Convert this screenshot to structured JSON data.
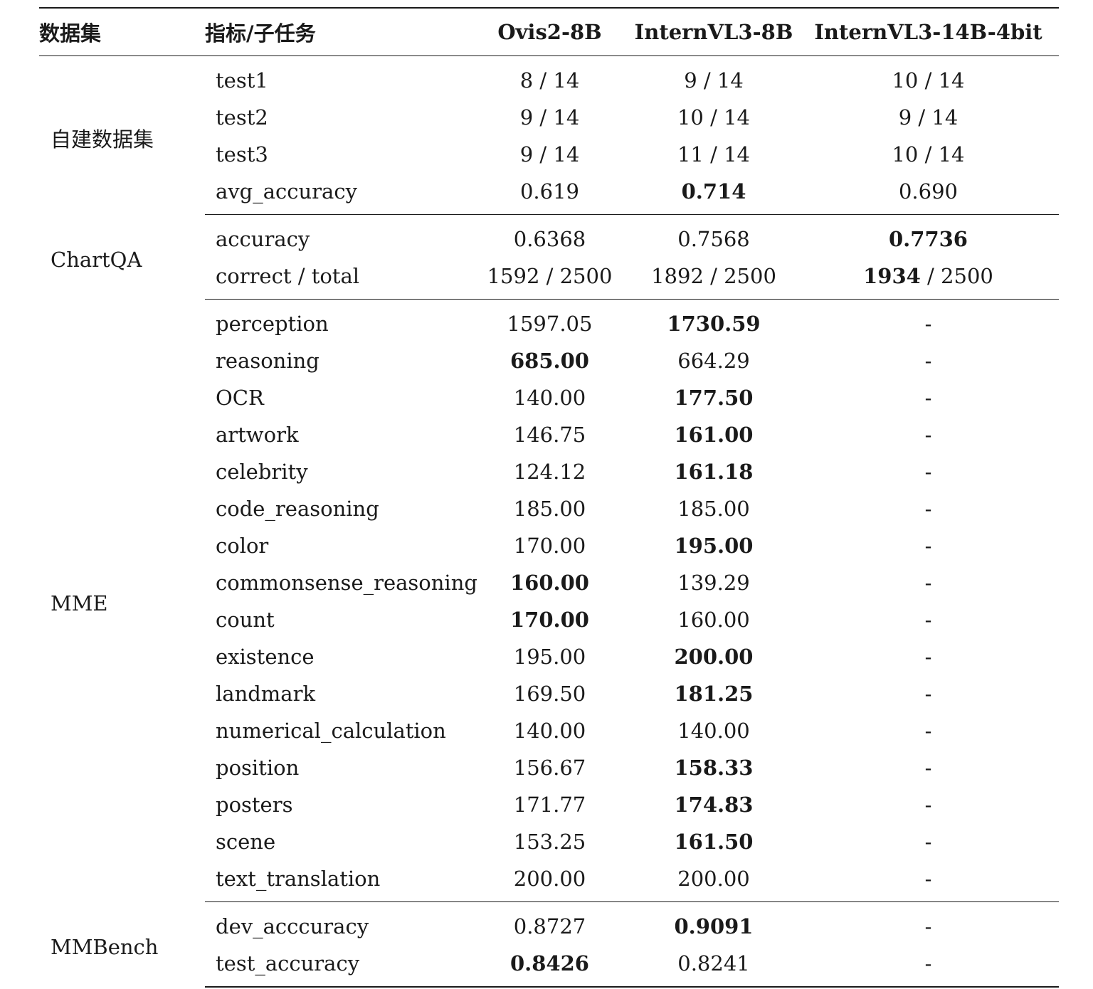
{
  "header": {
    "dataset": "数据集",
    "metric": "指标/子任务",
    "model1": "Ovis2-8B",
    "model2": "InternVL3-8B",
    "model3": "InternVL3-14B-4bit"
  },
  "groups": [
    {
      "dataset": "自建数据集",
      "rows": [
        {
          "metric": "test1",
          "m1": "8 / 14",
          "m2": "9 / 14",
          "m3": "10 / 14"
        },
        {
          "metric": "test2",
          "m1": "9 / 14",
          "m2": "10 / 14",
          "m3": "9 / 14"
        },
        {
          "metric": "test3",
          "m1": "9 / 14",
          "m2": "11 / 14",
          "m3": "10 / 14"
        },
        {
          "metric": "avg_accuracy",
          "m1": "0.619",
          "m2": "0.714",
          "m3": "0.690"
        }
      ]
    },
    {
      "dataset": "ChartQA",
      "rows": [
        {
          "metric": "accuracy",
          "m1": "0.6368",
          "m2": "0.7568",
          "m3": "0.7736"
        },
        {
          "metric": "correct / total",
          "m1": "1592 / 2500",
          "m2": "1892 / 2500",
          "m3_bold": "1934",
          "m3_rest": " / 2500"
        }
      ]
    },
    {
      "dataset": "MME",
      "rows": [
        {
          "metric": "perception",
          "m1": "1597.05",
          "m2": "1730.59",
          "m3": "-"
        },
        {
          "metric": "reasoning",
          "m1": "685.00",
          "m2": "664.29",
          "m3": "-"
        },
        {
          "metric": "OCR",
          "m1": "140.00",
          "m2": "177.50",
          "m3": "-"
        },
        {
          "metric": "artwork",
          "m1": "146.75",
          "m2": "161.00",
          "m3": "-"
        },
        {
          "metric": "celebrity",
          "m1": "124.12",
          "m2": "161.18",
          "m3": "-"
        },
        {
          "metric": "code_reasoning",
          "m1": "185.00",
          "m2": "185.00",
          "m3": "-"
        },
        {
          "metric": "color",
          "m1": "170.00",
          "m2": "195.00",
          "m3": "-"
        },
        {
          "metric": "commonsense_reasoning",
          "m1": "160.00",
          "m2": "139.29",
          "m3": "-"
        },
        {
          "metric": "count",
          "m1": "170.00",
          "m2": "160.00",
          "m3": "-"
        },
        {
          "metric": "existence",
          "m1": "195.00",
          "m2": "200.00",
          "m3": "-"
        },
        {
          "metric": "landmark",
          "m1": "169.50",
          "m2": "181.25",
          "m3": "-"
        },
        {
          "metric": "numerical_calculation",
          "m1": "140.00",
          "m2": "140.00",
          "m3": "-"
        },
        {
          "metric": "position",
          "m1": "156.67",
          "m2": "158.33",
          "m3": "-"
        },
        {
          "metric": "posters",
          "m1": "171.77",
          "m2": "174.83",
          "m3": "-"
        },
        {
          "metric": "scene",
          "m1": "153.25",
          "m2": "161.50",
          "m3": "-"
        },
        {
          "metric": "text_translation",
          "m1": "200.00",
          "m2": "200.00",
          "m3": "-"
        }
      ]
    },
    {
      "dataset": "MMBench",
      "rows": [
        {
          "metric": "dev_acccuracy",
          "m1": "0.8727",
          "m2": "0.9091",
          "m3": "-"
        },
        {
          "metric": "test_accuracy",
          "m1": "0.8426",
          "m2": "0.8241",
          "m3": "-"
        }
      ]
    }
  ]
}
